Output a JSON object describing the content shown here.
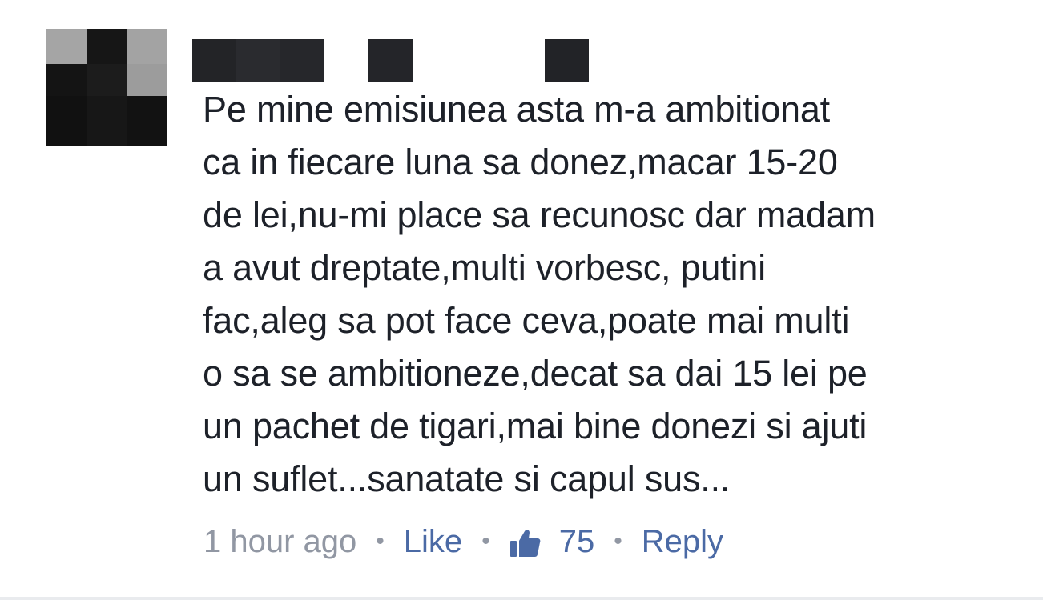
{
  "comment": {
    "body_lines": [
      "Pe mine emisiunea asta m-a ambitionat",
      "ca in fiecare luna sa donez,macar 15-20",
      "de lei,nu-mi place sa recunosc dar madam",
      "a avut dreptate,multi vorbesc, putini",
      "fac,aleg sa pot face ceva,poate mai multi",
      "o sa se ambitioneze,decat sa dai 15 lei pe",
      "un pachet de tigari,mai bine donezi si ajuti",
      "un suflet...sanatate si capul sus..."
    ],
    "timestamp": "1 hour ago",
    "separator": "•",
    "like_label": "Like",
    "like_count": "75",
    "reply_label": "Reply",
    "like_icon": "thumbs-up-icon"
  },
  "colors": {
    "text": "#1d2129",
    "meta": "#9197a3",
    "link": "#4b6aa5"
  }
}
